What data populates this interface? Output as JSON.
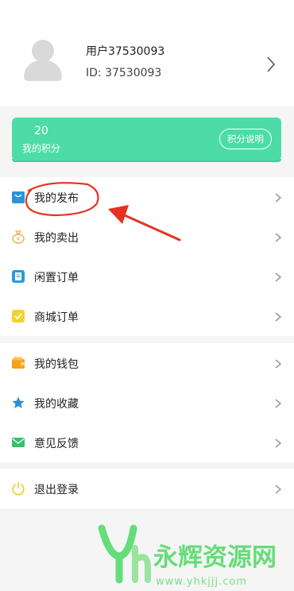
{
  "profile": {
    "username": "用户37530093",
    "user_id": "ID: 37530093"
  },
  "points": {
    "value": "20",
    "label": "我的积分",
    "explain_button": "积分说明"
  },
  "menu_group_1": [
    {
      "label": "我的发布",
      "icon": "shopping-bag-icon"
    },
    {
      "label": "我的卖出",
      "icon": "money-bag-icon"
    },
    {
      "label": "闲置订单",
      "icon": "clipboard-icon"
    },
    {
      "label": "商城订单",
      "icon": "checklist-icon"
    }
  ],
  "menu_group_2": [
    {
      "label": "我的钱包",
      "icon": "wallet-icon"
    },
    {
      "label": "我的收藏",
      "icon": "star-icon"
    },
    {
      "label": "意见反馈",
      "icon": "mail-icon"
    }
  ],
  "menu_group_3": [
    {
      "label": "退出登录",
      "icon": "power-icon"
    }
  ],
  "watermark": {
    "name": "永辉资源网",
    "url": "www.yhkjjj.com"
  },
  "colors": {
    "accent": "#4ddca7",
    "annotation_red": "#e53323",
    "watermark_green": "#4cd964"
  }
}
